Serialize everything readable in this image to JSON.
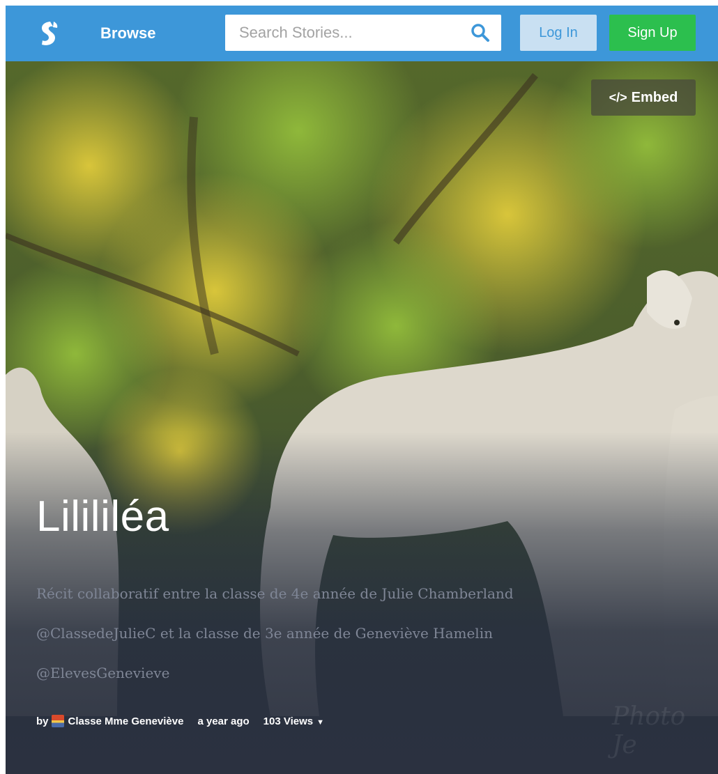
{
  "header": {
    "browse_label": "Browse",
    "search_placeholder": "Search Stories...",
    "login_label": "Log In",
    "signup_label": "Sign Up"
  },
  "hero": {
    "embed_label": "Embed",
    "title": "Lilililéa",
    "description": "Récit collaboratif entre la classe de 4e année de Julie Chamberland @ClassedeJulieC et la classe de 3e année de Geneviève Hamelin @ElevesGenevieve",
    "byline": {
      "by": "by",
      "author": "Classe Mme Geneviève",
      "time": "a year ago",
      "views": "103 Views"
    },
    "watermark": "Photo Je"
  },
  "colors": {
    "header_bg": "#3d97d9",
    "signup_bg": "#2cbf4e",
    "login_bg": "#c9e0f2"
  }
}
